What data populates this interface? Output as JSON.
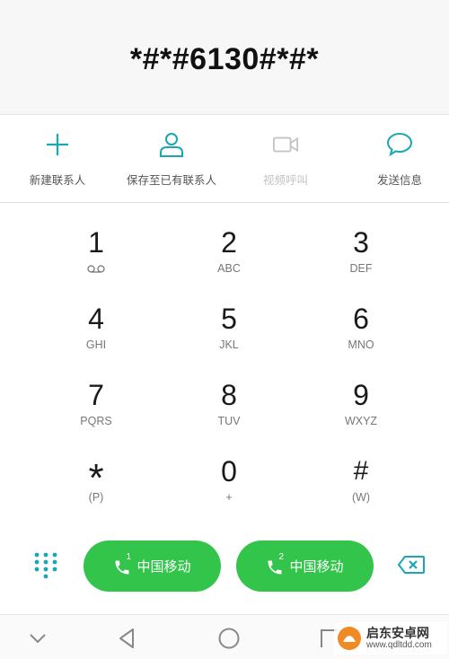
{
  "display": {
    "number": "*#*#6130#*#*"
  },
  "actions": [
    {
      "label": "新建联系人",
      "icon": "plus-icon"
    },
    {
      "label": "保存至已有联系人",
      "icon": "person-icon"
    },
    {
      "label": "视频呼叫",
      "icon": "video-camera-icon",
      "disabled": true
    },
    {
      "label": "发送信息",
      "icon": "chat-bubble-icon"
    }
  ],
  "keypad": {
    "k1": {
      "digit": "1",
      "sub": "",
      "sub_icon": "voicemail-icon"
    },
    "k2": {
      "digit": "2",
      "sub": "ABC"
    },
    "k3": {
      "digit": "3",
      "sub": "DEF"
    },
    "k4": {
      "digit": "4",
      "sub": "GHI"
    },
    "k5": {
      "digit": "5",
      "sub": "JKL"
    },
    "k6": {
      "digit": "6",
      "sub": "MNO"
    },
    "k7": {
      "digit": "7",
      "sub": "PQRS"
    },
    "k8": {
      "digit": "8",
      "sub": "TUV"
    },
    "k9": {
      "digit": "9",
      "sub": "WXYZ"
    },
    "kstar": {
      "digit": "*",
      "sub": "(P)"
    },
    "k0": {
      "digit": "0",
      "sub": "+"
    },
    "khash": {
      "digit": "#",
      "sub": "(W)"
    }
  },
  "call_buttons": [
    {
      "sim": "1",
      "carrier": "中国移动"
    },
    {
      "sim": "2",
      "carrier": "中国移动"
    }
  ],
  "colors": {
    "accent_teal": "#1aa6b4",
    "call_green": "#33c44c",
    "disabled": "#c4c4c4"
  },
  "watermark": {
    "text": "启东安卓网",
    "url": "www.qdltdd.com"
  }
}
